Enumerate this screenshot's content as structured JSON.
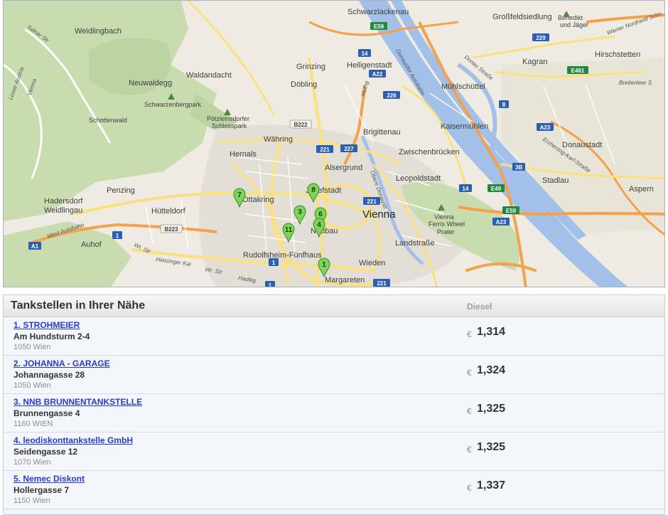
{
  "map": {
    "places": [
      {
        "id": "weidlingbach",
        "label": "Weidlingbach"
      },
      {
        "id": "waldandacht",
        "label": "Waldandacht"
      },
      {
        "id": "neuwaldegg",
        "label": "Neuwaldegg"
      },
      {
        "id": "grinzing",
        "label": "Grinzing"
      },
      {
        "id": "heiligenstadt",
        "label": "Heiligenstadt"
      },
      {
        "id": "doebling",
        "label": "Döbling"
      },
      {
        "id": "schwarzlackenau",
        "label": "Schwarzlackenau"
      },
      {
        "id": "grossfeldsiedlung",
        "label": "Großfeldsiedlung"
      },
      {
        "id": "kagran",
        "label": "Kagran"
      },
      {
        "id": "hirschstetten",
        "label": "Hirschstetten"
      },
      {
        "id": "muehlschuettel",
        "label": "Mühlschüttel"
      },
      {
        "id": "kaisermuehlen",
        "label": "Kaisermühlen"
      },
      {
        "id": "donaustadt",
        "label": "Donaustadt"
      },
      {
        "id": "stadlau",
        "label": "Stadlau"
      },
      {
        "id": "aspern",
        "label": "Aspern"
      },
      {
        "id": "waehring",
        "label": "Währing"
      },
      {
        "id": "hernals",
        "label": "Hernals"
      },
      {
        "id": "brigittenau",
        "label": "Brigittenau"
      },
      {
        "id": "zwischenbruecken",
        "label": "Zwischenbrücken"
      },
      {
        "id": "alsergrund",
        "label": "Alsergrund"
      },
      {
        "id": "leopoldstadt",
        "label": "Leopoldstadt"
      },
      {
        "id": "penzing",
        "label": "Penzing"
      },
      {
        "id": "hadersdorf",
        "label": "Hadersdorf"
      },
      {
        "id": "weidlingau",
        "label": "Weidlingau"
      },
      {
        "id": "huetteldorf",
        "label": "Hütteldorf"
      },
      {
        "id": "ottakring",
        "label": "Ottakring"
      },
      {
        "id": "josefstadt",
        "label": "Josefstadt"
      },
      {
        "id": "neubau",
        "label": "Neubau"
      },
      {
        "id": "landstrasse",
        "label": "Landstraße"
      },
      {
        "id": "auhof",
        "label": "Auhof"
      },
      {
        "id": "rudolfsheim",
        "label": "Rudolfsheim-Fünfhaus"
      },
      {
        "id": "wieden",
        "label": "Wieden"
      },
      {
        "id": "margareten",
        "label": "Margareten"
      },
      {
        "id": "vienna",
        "label": "Vienna"
      }
    ],
    "pois": [
      {
        "id": "schwarzenbergpark",
        "label": "Schwarzenbergpark"
      },
      {
        "id": "schottenwald",
        "label": "Schottenwald"
      },
      {
        "id": "poetzleinsdorf1",
        "label": "Pötzleinsdorfer"
      },
      {
        "id": "poetzleinsdorf2",
        "label": "Schlosspark"
      },
      {
        "id": "benedikt1",
        "label": "Benedikt"
      },
      {
        "id": "benedikt2",
        "label": "und Jäger"
      },
      {
        "id": "ferris1",
        "label": "Vienna"
      },
      {
        "id": "ferris2",
        "label": "Ferris Wheel"
      },
      {
        "id": "prater",
        "label": "Prater"
      }
    ],
    "roads": [
      {
        "id": "tullner",
        "label": "Tullner Str"
      },
      {
        "id": "loweraustria",
        "label": "Lower Austria"
      },
      {
        "id": "vienna_rd",
        "label": "Vienna"
      },
      {
        "id": "donauufer",
        "label": "Donauufer Autobahn"
      },
      {
        "id": "donaustrasse",
        "label": "Donau Straße"
      },
      {
        "id": "breitenleer",
        "label": "Breitenleer S"
      },
      {
        "id": "nordrand",
        "label": "Wiener Nordrand Schn"
      },
      {
        "id": "erzherzog",
        "label": "Erzherzog-Karl-Straße"
      },
      {
        "id": "obere_donau",
        "label": "Obere Donaustr"
      },
      {
        "id": "muthg",
        "label": "Muthg"
      },
      {
        "id": "westautobahn",
        "label": "West Autobahn"
      },
      {
        "id": "hietzinger",
        "label": "Hietzinger Kai"
      },
      {
        "id": "wr_str1",
        "label": "Wr. Str"
      },
      {
        "id": "wr_str2",
        "label": "Wr. Str"
      },
      {
        "id": "hadik",
        "label": "Hadikg"
      }
    ],
    "shields": [
      {
        "id": "e59a",
        "label": "E59",
        "kind": "euro"
      },
      {
        "id": "s14",
        "label": "14",
        "kind": "blue"
      },
      {
        "id": "a22",
        "label": "A22",
        "kind": "blue"
      },
      {
        "id": "s226",
        "label": "226",
        "kind": "blue"
      },
      {
        "id": "s229",
        "label": "229",
        "kind": "blue"
      },
      {
        "id": "e461",
        "label": "E461",
        "kind": "euro"
      },
      {
        "id": "s8",
        "label": "8",
        "kind": "blue"
      },
      {
        "id": "a23a",
        "label": "A23",
        "kind": "blue"
      },
      {
        "id": "b222",
        "label": "B222",
        "kind": "plain"
      },
      {
        "id": "s221a",
        "label": "221",
        "kind": "blue"
      },
      {
        "id": "s227",
        "label": "227",
        "kind": "blue"
      },
      {
        "id": "s3b",
        "label": "3B",
        "kind": "blue"
      },
      {
        "id": "e49",
        "label": "E49",
        "kind": "euro"
      },
      {
        "id": "s14b",
        "label": "14",
        "kind": "blue"
      },
      {
        "id": "s221b",
        "label": "221",
        "kind": "blue"
      },
      {
        "id": "e59b",
        "label": "E59",
        "kind": "euro"
      },
      {
        "id": "a23b",
        "label": "A23",
        "kind": "blue"
      },
      {
        "id": "b223",
        "label": "B223",
        "kind": "plain"
      },
      {
        "id": "s1a",
        "label": "1",
        "kind": "blue"
      },
      {
        "id": "a1",
        "label": "A1",
        "kind": "blue"
      },
      {
        "id": "s1b",
        "label": "1",
        "kind": "blue"
      },
      {
        "id": "s1c",
        "label": "1",
        "kind": "blue"
      },
      {
        "id": "s221c",
        "label": "221",
        "kind": "blue"
      }
    ],
    "markers": [
      {
        "id": "m7",
        "label": "7"
      },
      {
        "id": "m8",
        "label": "8"
      },
      {
        "id": "m3",
        "label": "3"
      },
      {
        "id": "m6",
        "label": "6"
      },
      {
        "id": "m4",
        "label": "4"
      },
      {
        "id": "m11",
        "label": "11"
      },
      {
        "id": "m1",
        "label": "1"
      }
    ]
  },
  "panel": {
    "title": "Tankstellen in Ihrer Nähe",
    "column": "Diesel",
    "currency": "€",
    "stations": [
      {
        "name": "1. STROHMEIER",
        "street": "Am Hundsturm 2-4",
        "city": "1050 Wien",
        "price": "1,314"
      },
      {
        "name": "2. JOHANNA - GARAGE",
        "street": "Johannagasse 28",
        "city": "1050 Wien",
        "price": "1,324"
      },
      {
        "name": "3. NNB BRUNNENTANKSTELLE",
        "street": "Brunnengasse 4",
        "city": "1160 WIEN",
        "price": "1,325"
      },
      {
        "name": "4. leodiskonttankstelle GmbH",
        "street": "Seidengasse 12",
        "city": "1070 Wien",
        "price": "1,325"
      },
      {
        "name": "5. Nemec Diskont",
        "street": "Hollergasse 7",
        "city": "1150 Wien",
        "price": "1,337"
      }
    ]
  },
  "colors": {
    "link": "#2a3ad0",
    "danube": "#a3c0e8",
    "motorway": "#f5a04a",
    "road": "#fbe17d",
    "forest": "#c9dcb0",
    "marker": "#7cd45a"
  }
}
